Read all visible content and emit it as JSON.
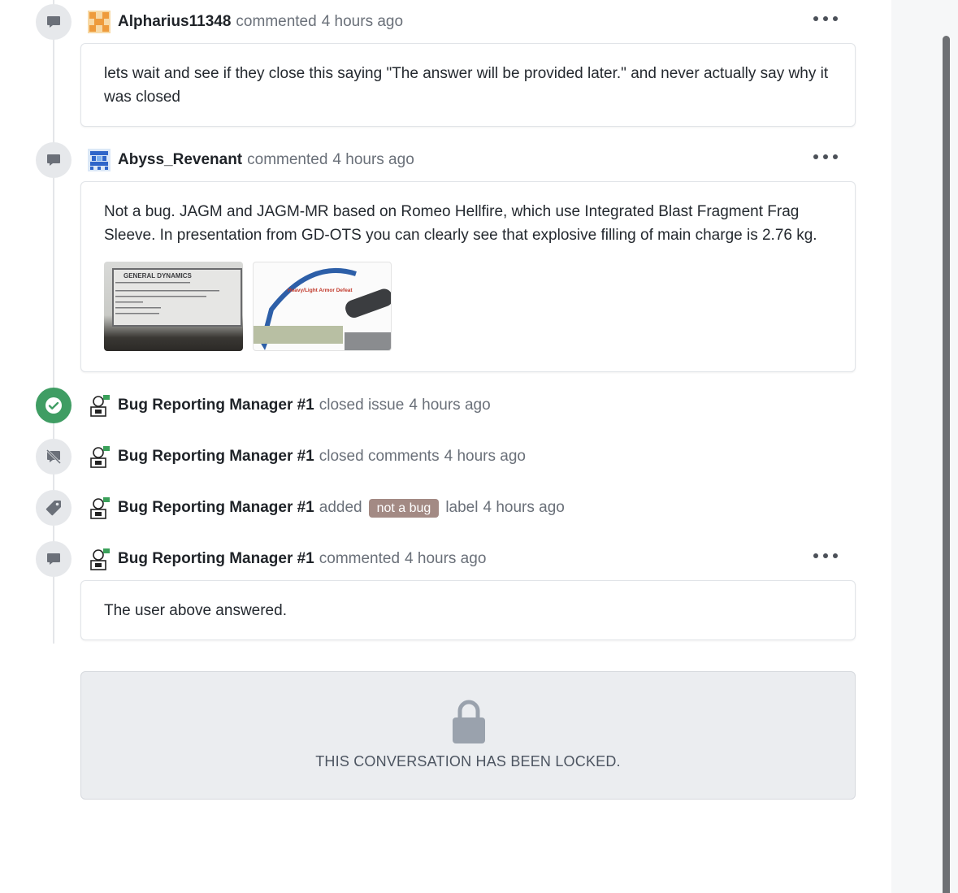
{
  "timeline": {
    "items": [
      {
        "type": "comment",
        "author": "Alpharius11348",
        "action": "commented",
        "time": "4 hours ago",
        "icon": "comment-icon",
        "body": "lets wait and see if they close this saying \"The answer will be provided later.\" and never actually say why it was closed"
      },
      {
        "type": "comment",
        "author": "Abyss_Revenant",
        "action": "commented",
        "time": "4 hours ago",
        "icon": "comment-icon",
        "body": "Not a bug. JAGM and JAGM-MR based on Romeo Hellfire, which use Integrated Blast Fragment Frag Sleeve. In presentation from GD-OTS you can clearly see that explosive filling of main charge is 2.76 kg.",
        "attachments": [
          {
            "name": "general-dynamics-label-photo",
            "text": "GENERAL DYNAMICS"
          },
          {
            "name": "heavy-light-armor-defeat-slide",
            "text": "Heavy/Light Armor Defeat"
          }
        ]
      },
      {
        "type": "event",
        "author": "Bug Reporting Manager #1",
        "action": "closed issue",
        "time": "4 hours ago",
        "icon": "check-circle-icon"
      },
      {
        "type": "event",
        "author": "Bug Reporting Manager #1",
        "action": "closed comments",
        "time": "4 hours ago",
        "icon": "comment-off-icon"
      },
      {
        "type": "event",
        "author": "Bug Reporting Manager #1",
        "action": "added",
        "label": "not a bug",
        "suffix": "label",
        "time": "4 hours ago",
        "icon": "tag-icon",
        "label_color": "#a38a84"
      },
      {
        "type": "comment",
        "author": "Bug Reporting Manager #1",
        "action": "commented",
        "time": "4 hours ago",
        "icon": "comment-icon",
        "body": "The user above answered."
      }
    ]
  },
  "locked": {
    "message": "THIS CONVERSATION HAS BEEN LOCKED.",
    "icon": "lock-icon"
  },
  "colors": {
    "closed_green": "#3f9d63",
    "label_bg": "#a38a84",
    "icon_bg": "#e6e8eb"
  }
}
